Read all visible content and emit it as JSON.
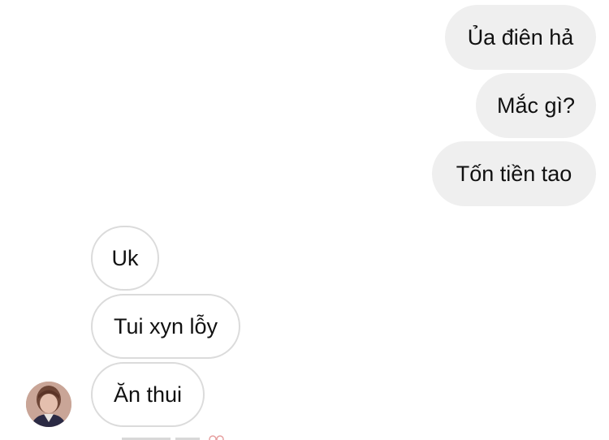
{
  "conversation": {
    "sent": [
      {
        "text": "Ủa điên hả"
      },
      {
        "text": "Mắc gì?"
      },
      {
        "text": "Tốn tiền tao"
      }
    ],
    "received": [
      {
        "text": "Uk"
      },
      {
        "text": "Tui xyn lỗy"
      },
      {
        "text": "Ăn thui"
      }
    ],
    "avatar_icon": "user-avatar-photo",
    "colors": {
      "sent_bubble": "#efefef",
      "received_border": "#dbdbdb",
      "text": "#111111"
    }
  }
}
